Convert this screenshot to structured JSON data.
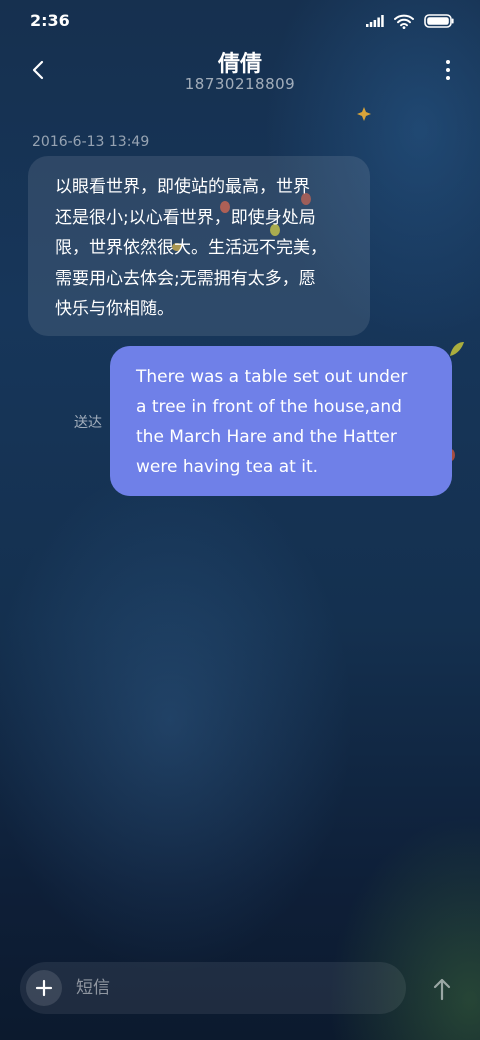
{
  "status_bar": {
    "time": "2:36",
    "icons": [
      "signal-icon",
      "wifi-icon",
      "battery-icon"
    ]
  },
  "header": {
    "contact_name": "倩倩",
    "contact_number": "18730218809",
    "back_icon": "chevron-left-icon",
    "menu_icon": "more-vertical-icon"
  },
  "conversation": {
    "timestamp": "2016-6-13 13:49",
    "incoming": {
      "lines": [
        "以眼看世界，即使站的最高，世界",
        "还是很小;以心看世界，即使身处局",
        "限，世界依然很大。生活远不完美，",
        "需要用心去体会;无需拥有太多，愿",
        "快乐与你相随。"
      ]
    },
    "outgoing": {
      "lines": [
        "There was a table set out under",
        "a tree in front of the house,and",
        "the March Hare and the Hatter",
        "were having tea at it."
      ],
      "status": "送达"
    }
  },
  "composer": {
    "placeholder": "短信",
    "add_icon": "plus-icon",
    "send_icon": "arrow-up-icon"
  },
  "colors": {
    "outgoing_bubble": "#6f80e8",
    "incoming_bubble": "rgba(255,255,255,0.10)",
    "background_top": "#16304f",
    "background_bottom": "#0c1a2e"
  }
}
